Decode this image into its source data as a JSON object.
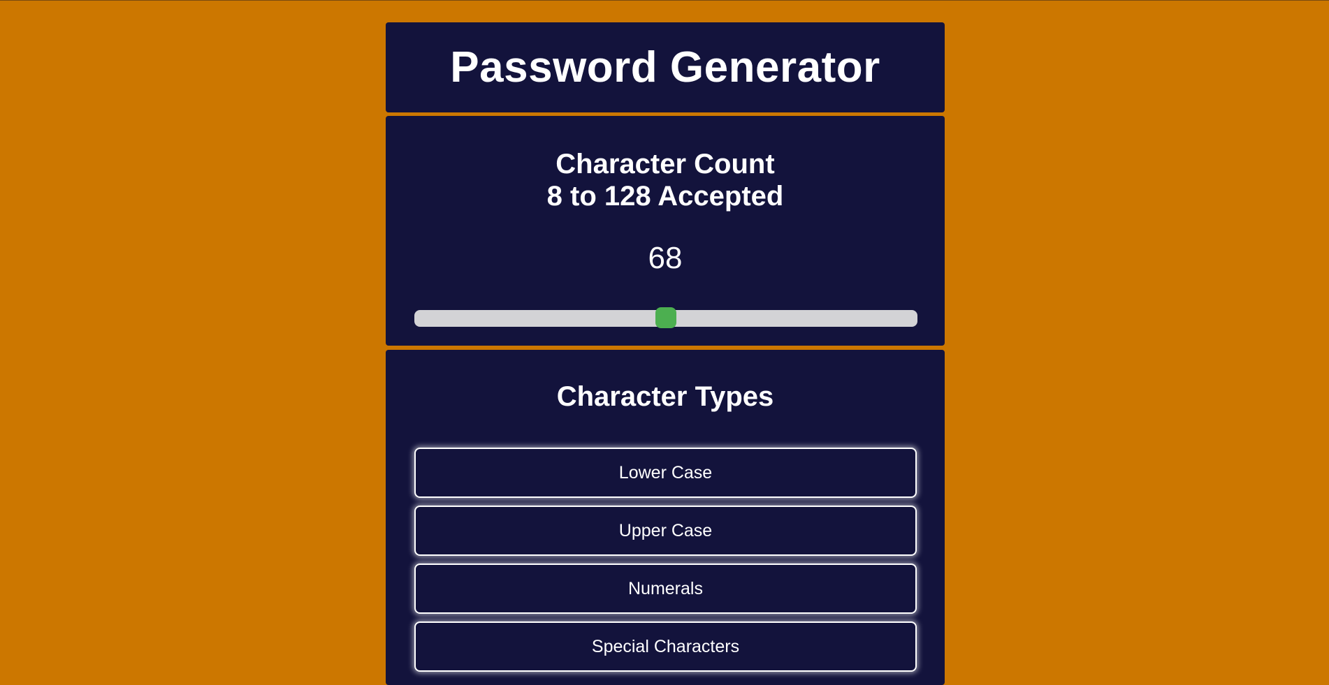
{
  "header": {
    "title": "Password Generator"
  },
  "character_count": {
    "heading_line1": "Character Count",
    "heading_line2": "8 to 128 Accepted",
    "value": "68",
    "slider": {
      "min": 8,
      "max": 128,
      "current": 68
    }
  },
  "character_types": {
    "heading": "Character Types",
    "options": [
      {
        "label": "Lower Case"
      },
      {
        "label": "Upper Case"
      },
      {
        "label": "Numerals"
      },
      {
        "label": "Special Characters"
      }
    ]
  },
  "colors": {
    "background": "#cc7700",
    "panel": "#13133c",
    "text": "#ffffff",
    "slider_track": "#d3d3d6",
    "slider_thumb": "#4caf50"
  }
}
